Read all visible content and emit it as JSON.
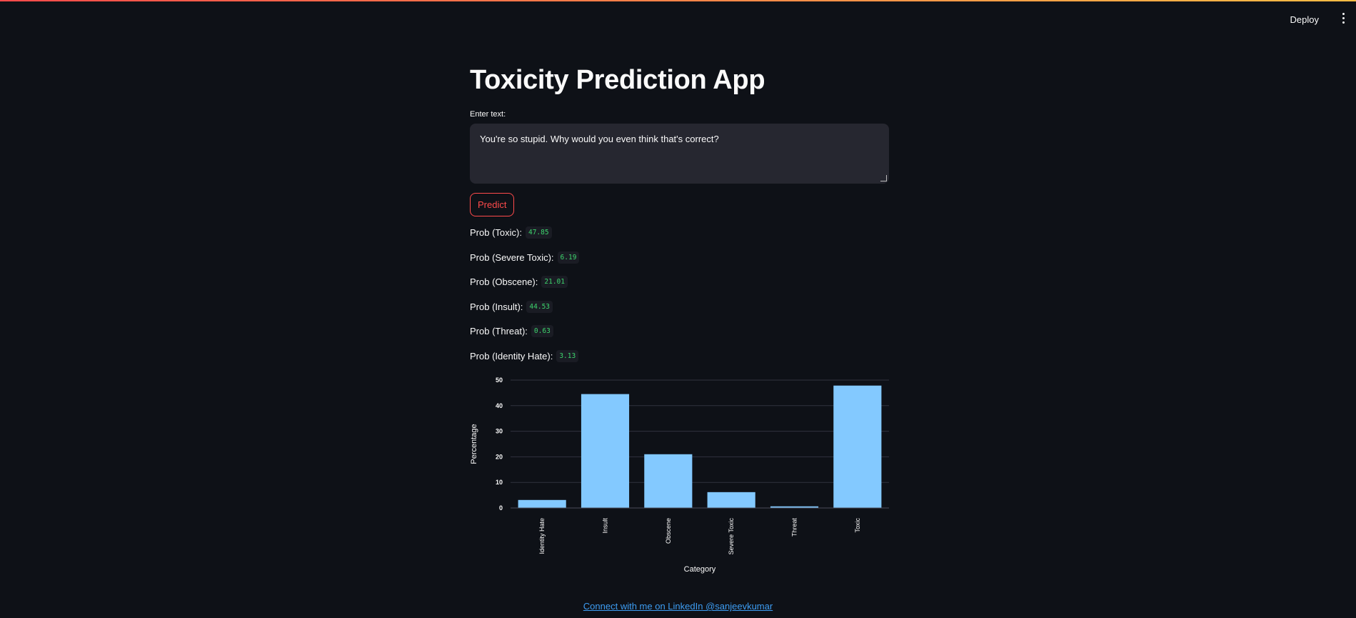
{
  "header": {
    "deploy_label": "Deploy",
    "menu_icon": "vertical-ellipsis"
  },
  "main": {
    "title": "Toxicity Prediction App",
    "input_label": "Enter text:",
    "input_value": "You're so stupid. Why would you even think that's correct?",
    "predict_label": "Predict",
    "probs": [
      {
        "label": "Prob (Toxic):",
        "value": "47.85"
      },
      {
        "label": "Prob (Severe Toxic):",
        "value": "6.19"
      },
      {
        "label": "Prob (Obscene):",
        "value": "21.01"
      },
      {
        "label": "Prob (Insult):",
        "value": "44.53"
      },
      {
        "label": "Prob (Threat):",
        "value": "0.63"
      },
      {
        "label": "Prob (Identity Hate):",
        "value": "3.13"
      }
    ]
  },
  "chart_data": {
    "type": "bar",
    "categories": [
      "Identity Hate",
      "Insult",
      "Obscene",
      "Severe Toxic",
      "Threat",
      "Toxic"
    ],
    "values": [
      3.13,
      44.53,
      21.01,
      6.19,
      0.63,
      47.85
    ],
    "xlabel": "Category",
    "ylabel": "Percentage",
    "ylim": [
      0,
      50
    ],
    "yticks": [
      0,
      10,
      20,
      30,
      40,
      50
    ],
    "bar_color": "#83c9ff",
    "grid": true
  },
  "footer": {
    "link_text": "Connect with me on LinkedIn @sanjeevkumar"
  },
  "colors": {
    "background": "#0e1117",
    "accent": "#ff4b4b",
    "code_text": "#3dd56d",
    "link": "#3d9df3"
  }
}
